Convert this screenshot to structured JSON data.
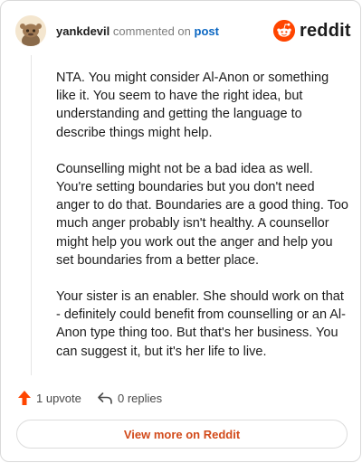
{
  "comment": {
    "author": "yankdevil",
    "action_text": "commented on",
    "target_link": "post",
    "paragraphs": [
      "NTA. You might consider Al-Anon or something like it. You seem to have the right idea, but understanding and getting the language to describe things might help.",
      "Counselling might not be a bad idea as well. You're setting boundaries but you don't need anger to do that. Boundaries are a good thing. Too much anger probably isn't healthy. A counsellor might help you work out the anger and help you set boundaries from a better place.",
      "Your sister is an enabler. She should work on that - definitely could benefit from counselling or an Al-Anon type thing too. But that's her business. You can suggest it, but it's her life to live."
    ],
    "upvote_label": "1 upvote",
    "replies_label": "0 replies"
  },
  "brand": {
    "name": "reddit",
    "color": "#ff4500"
  },
  "footer": {
    "view_more_label": "View more on Reddit"
  },
  "icons": {
    "avatar": "snoo-avatar-icon",
    "logo": "reddit-logo-icon",
    "upvote": "upvote-arrow-icon",
    "reply": "reply-arrow-icon"
  }
}
